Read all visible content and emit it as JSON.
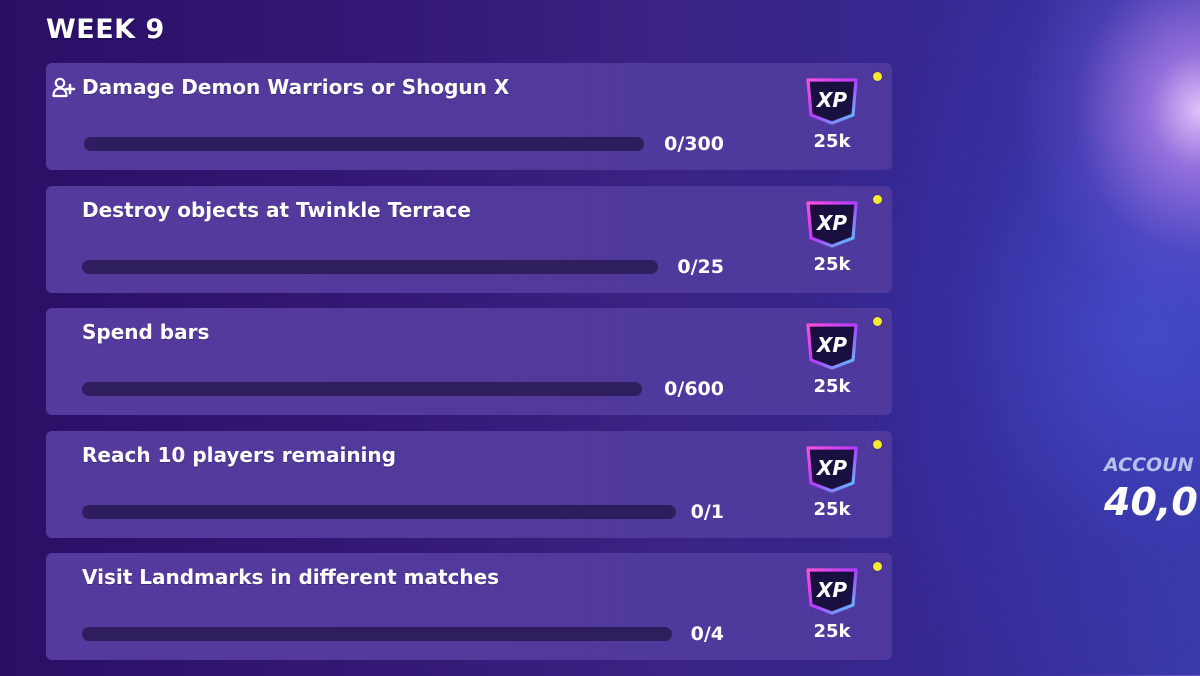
{
  "header": {
    "week_title": "WEEK 9"
  },
  "colors": {
    "card": "#573ea0",
    "track": "#2f1e5e",
    "new_dot": "#f5ea30",
    "xp_badge": "#1a1040",
    "xp_border": "#d94aff"
  },
  "quests": [
    {
      "name": "Damage Demon Warriors or Shogun X",
      "party_quest": true,
      "progress_text": "0/300",
      "progress_fraction": 0,
      "reward_label": "XP",
      "reward_amount": "25k",
      "is_new": true
    },
    {
      "name": "Destroy objects at Twinkle Terrace",
      "party_quest": false,
      "progress_text": "0/25",
      "progress_fraction": 0,
      "reward_label": "XP",
      "reward_amount": "25k",
      "is_new": true
    },
    {
      "name": "Spend bars",
      "party_quest": false,
      "progress_text": "0/600",
      "progress_fraction": 0,
      "reward_label": "XP",
      "reward_amount": "25k",
      "is_new": true
    },
    {
      "name": "Reach 10 players remaining",
      "party_quest": false,
      "progress_text": "0/1",
      "progress_fraction": 0,
      "reward_label": "XP",
      "reward_amount": "25k",
      "is_new": true
    },
    {
      "name": "Visit Landmarks in different matches",
      "party_quest": false,
      "progress_text": "0/4",
      "progress_fraction": 0,
      "reward_label": "XP",
      "reward_amount": "25k",
      "is_new": true
    }
  ],
  "account_panel": {
    "label": "ACCOUN",
    "value": "40,0"
  }
}
